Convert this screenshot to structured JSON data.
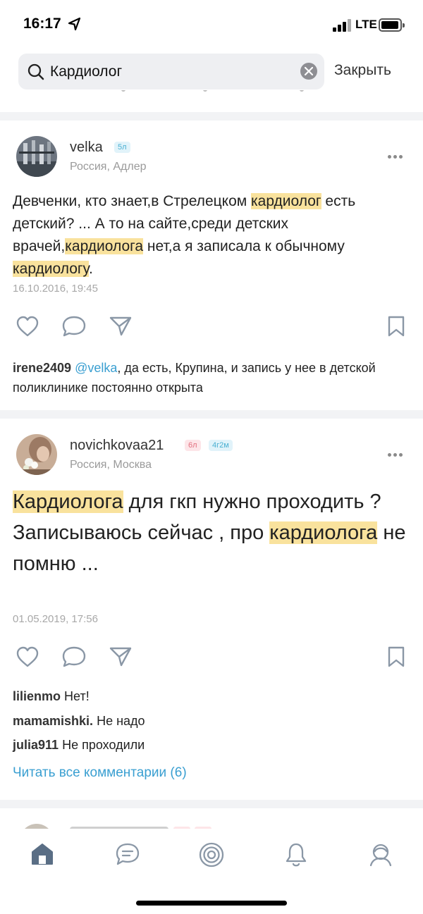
{
  "status_bar": {
    "time": "16:17",
    "network": "LTE"
  },
  "search": {
    "query": "Кардиолог",
    "close_label": "Закрыть"
  },
  "posts": [
    {
      "username": "velka",
      "badges": [
        "5л"
      ],
      "location": "Россия, Адлер",
      "text_parts": [
        "Девченки, кто знает,в Стрелецком ",
        "кардиолог",
        " есть детский? ... А то на сайте,среди детских врачей,",
        "кардиолога",
        " нет,а я записала к обычному ",
        "кардиологу",
        "."
      ],
      "date": "16.10.2016, 19:45",
      "comments": [
        {
          "user": "irene2409",
          "mention": "@velka",
          "text": ", да есть, Крупина, и запись у нее в детской поликлинике постоянно открыта"
        }
      ]
    },
    {
      "username": "novichkovaa21",
      "badges": [
        "6л",
        "4г2м"
      ],
      "location": "Россия, Москва",
      "text_parts": [
        "Кардиолога",
        " для гкп нужно проходить ?",
        "Записываюсь сейчас  , про ",
        "кардиолога",
        " не помню ..."
      ],
      "date": "01.05.2019, 17:56",
      "comments": [
        {
          "user": "lilienmo",
          "text": "Нет!"
        },
        {
          "user": "mamamishki.",
          "text": "Не надо"
        },
        {
          "user": "julia911",
          "text": "Не проходили"
        }
      ],
      "read_all": "Читать все комментарии (6)"
    }
  ],
  "tabs": [
    {
      "name": "home",
      "icon": "home-icon",
      "active": true
    },
    {
      "name": "messages",
      "icon": "chat-icon"
    },
    {
      "name": "feed",
      "icon": "target-icon"
    },
    {
      "name": "notifications",
      "icon": "bell-icon"
    },
    {
      "name": "profile",
      "icon": "profile-icon"
    }
  ],
  "colors": {
    "highlight": "#f9e29d",
    "link": "#3a9fd1",
    "icon": "#8a97a6",
    "active_tab": "#5a6e85"
  }
}
